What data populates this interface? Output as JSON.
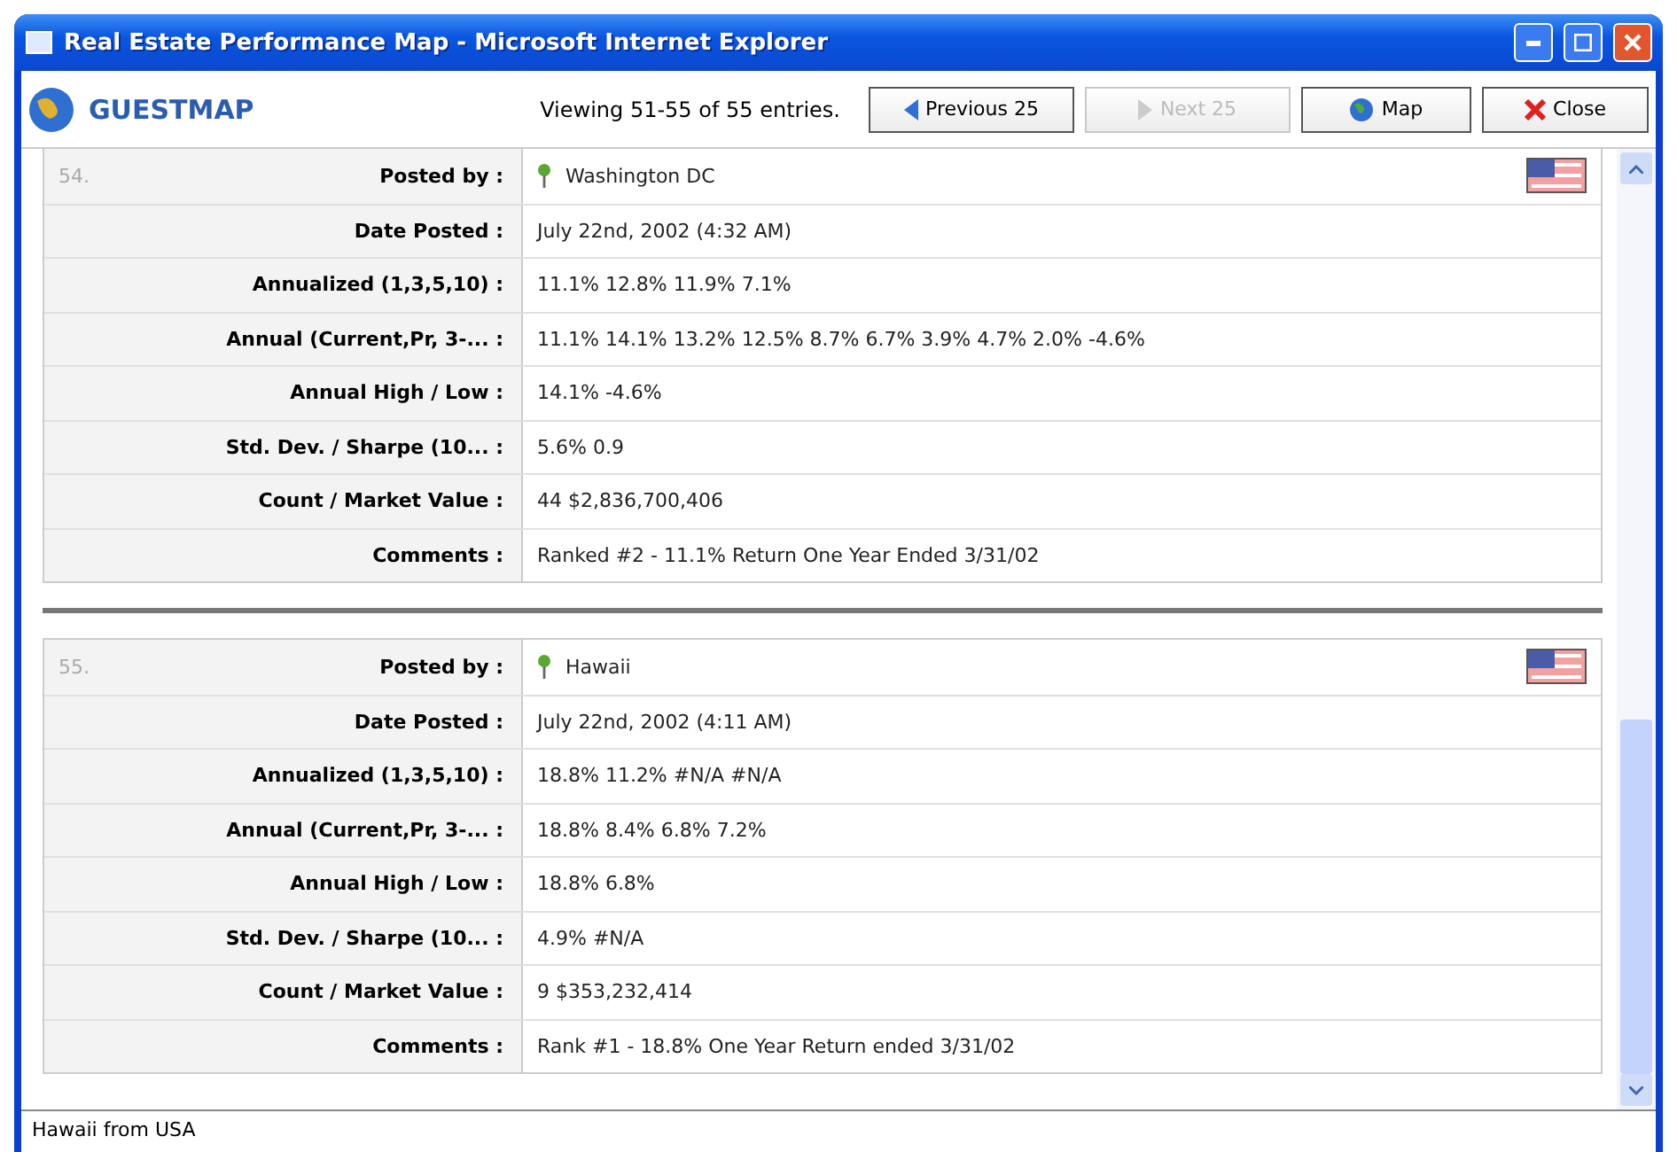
{
  "window": {
    "title": "Real Estate Performance Map - Microsoft Internet Explorer"
  },
  "toolbar": {
    "logo": "GUESTMAP",
    "viewing": "Viewing 51-55 of 55 entries.",
    "buttons": [
      {
        "kind": "previous",
        "label": "Previous 25",
        "disabled": false
      },
      {
        "kind": "next",
        "label": "Next 25",
        "disabled": true
      },
      {
        "kind": "map",
        "label": "Map",
        "disabled": false
      },
      {
        "kind": "close",
        "label": "Close",
        "disabled": false
      }
    ]
  },
  "entries": [
    {
      "number": "54.",
      "rows": [
        {
          "label": "Posted by :",
          "value": "Washington DC",
          "kind": "poster"
        },
        {
          "label": "Date Posted :",
          "value": "July 22nd, 2002 (4:32 AM)",
          "kind": "text"
        },
        {
          "label": "Annualized (1,3,5,10) :",
          "value": "11.1% 12.8% 11.9% 7.1%",
          "kind": "text"
        },
        {
          "label": "Annual (Current,Pr, 3-... :",
          "value": "11.1% 14.1% 13.2% 12.5% 8.7% 6.7% 3.9% 4.7% 2.0% -4.6%",
          "kind": "text"
        },
        {
          "label": "Annual High / Low :",
          "value": "14.1% -4.6%",
          "kind": "text"
        },
        {
          "label": "Std. Dev. / Sharpe (10... :",
          "value": "5.6% 0.9",
          "kind": "text"
        },
        {
          "label": "Count / Market Value :",
          "value": "44 $2,836,700,406",
          "kind": "text"
        },
        {
          "label": "Comments :",
          "value": "Ranked #2 - 11.1% Return One Year Ended 3/31/02",
          "kind": "text"
        }
      ]
    },
    {
      "number": "55.",
      "rows": [
        {
          "label": "Posted by :",
          "value": "Hawaii",
          "kind": "poster"
        },
        {
          "label": "Date Posted :",
          "value": "July 22nd, 2002 (4:11 AM)",
          "kind": "text"
        },
        {
          "label": "Annualized (1,3,5,10) :",
          "value": "18.8% 11.2% #N/A #N/A",
          "kind": "text"
        },
        {
          "label": "Annual (Current,Pr, 3-... :",
          "value": "18.8% 8.4% 6.8% 7.2%",
          "kind": "text"
        },
        {
          "label": "Annual High / Low :",
          "value": "18.8% 6.8%",
          "kind": "text"
        },
        {
          "label": "Std. Dev. / Sharpe (10... :",
          "value": "4.9% #N/A",
          "kind": "text"
        },
        {
          "label": "Count / Market Value :",
          "value": "9 $353,232,414",
          "kind": "text"
        },
        {
          "label": "Comments :",
          "value": "Rank #1 - 18.8% One Year Return ended 3/31/02",
          "kind": "text"
        }
      ]
    }
  ],
  "status_bar": "Hawaii from USA"
}
